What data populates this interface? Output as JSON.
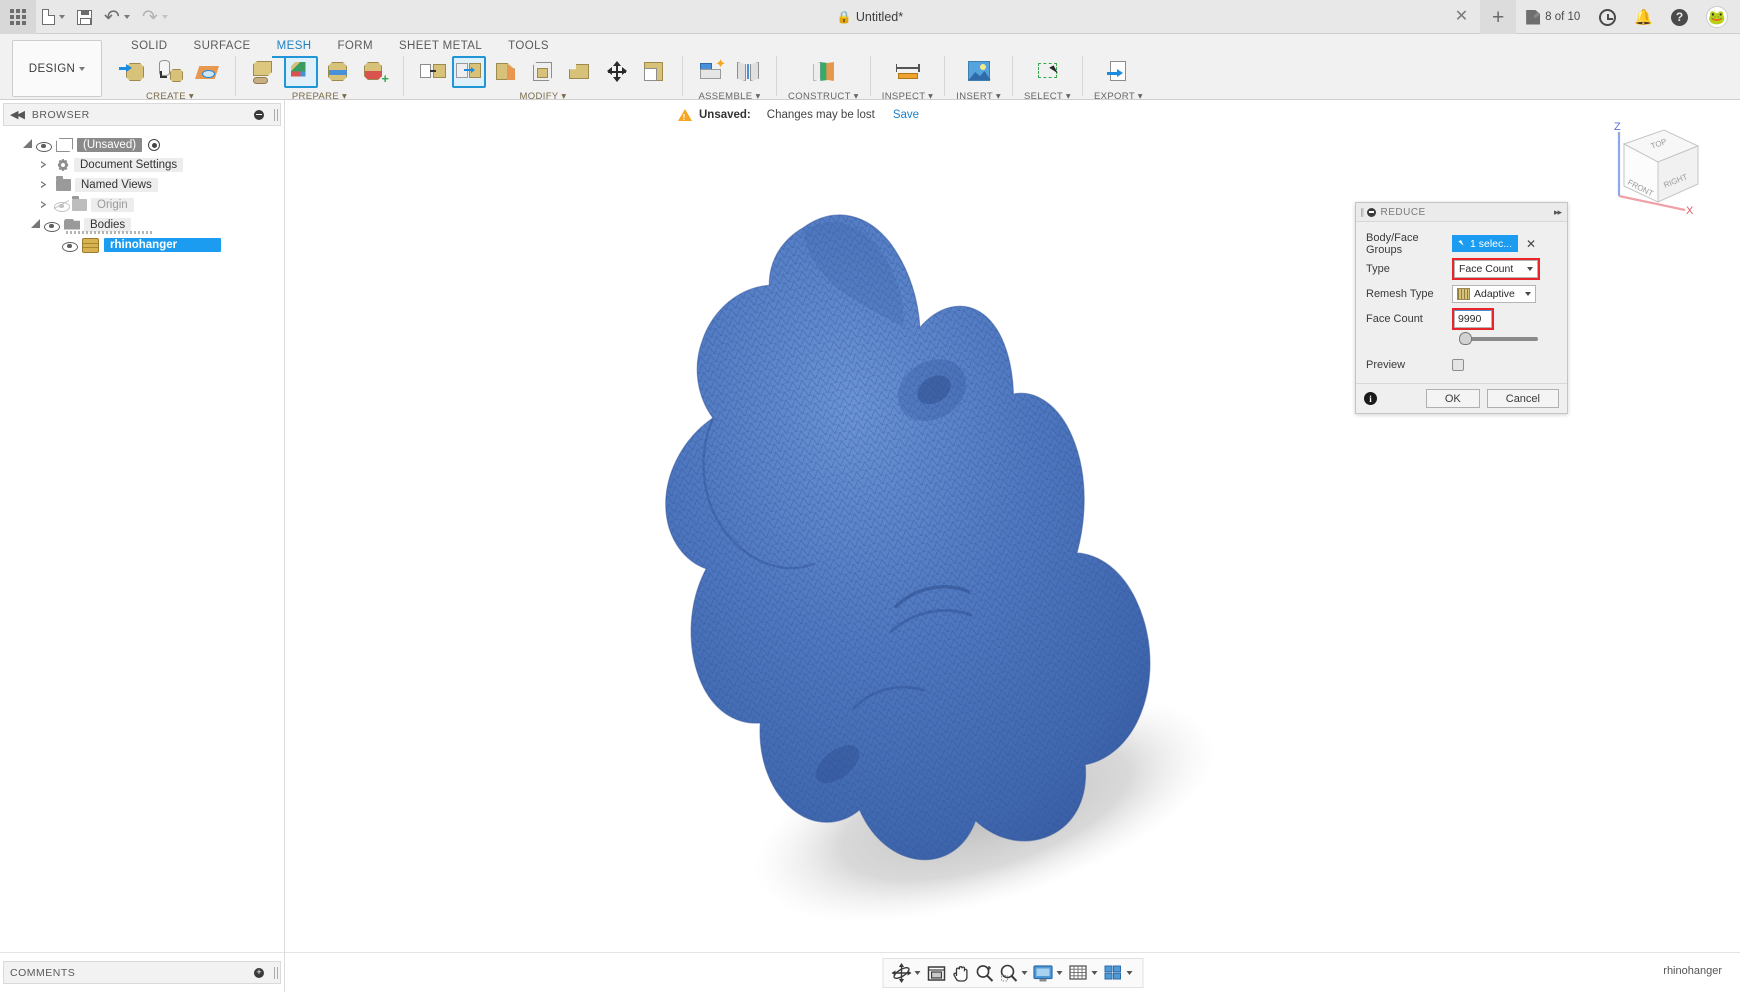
{
  "titlebar": {
    "app_menu_icon": "grid-icon",
    "new_doc_icon": "document-icon",
    "save_icon": "save-icon",
    "undo_icon": "undo-icon",
    "redo_icon": "redo-icon",
    "document_title": "Untitled*",
    "lock_icon": "lock-icon",
    "close_tab_icon": "close-icon",
    "new_tab_icon": "plus-icon",
    "job_status": "8 of 10",
    "job_icon": "pencil-document-icon",
    "recent_icon": "clock-icon",
    "notifications_icon": "bell-icon",
    "help_icon": "help-icon",
    "avatar_icon": "frog-avatar",
    "avatar_glyph": "🐸"
  },
  "ribbon": {
    "workspace_label": "DESIGN",
    "tabs": [
      {
        "label": "SOLID",
        "active": false
      },
      {
        "label": "SURFACE",
        "active": false
      },
      {
        "label": "MESH",
        "active": true
      },
      {
        "label": "FORM",
        "active": false
      },
      {
        "label": "SHEET METAL",
        "active": false
      },
      {
        "label": "TOOLS",
        "active": false
      }
    ],
    "groups": [
      {
        "label": "CREATE ▾",
        "name": "create"
      },
      {
        "label": "PREPARE ▾",
        "name": "prepare"
      },
      {
        "label": "MODIFY ▾",
        "name": "modify"
      },
      {
        "label": "ASSEMBLE ▾",
        "name": "assemble"
      },
      {
        "label": "CONSTRUCT ▾",
        "name": "construct"
      },
      {
        "label": "INSPECT ▾",
        "name": "inspect"
      },
      {
        "label": "INSERT ▾",
        "name": "insert"
      },
      {
        "label": "SELECT ▾",
        "name": "select"
      },
      {
        "label": "EXPORT ▾",
        "name": "export"
      }
    ]
  },
  "browser": {
    "header_title": "BROWSER",
    "collapse_icon": "collapse-left-icon",
    "minimize_icon": "minus-circle-icon",
    "tree": [
      {
        "label": "(Unsaved)",
        "icon": "document-cube-icon",
        "state": "unsaved",
        "indent": 0
      },
      {
        "label": "Document Settings",
        "icon": "gear-icon",
        "state": "normal",
        "indent": 1
      },
      {
        "label": "Named Views",
        "icon": "folder-icon",
        "state": "normal",
        "indent": 1
      },
      {
        "label": "Origin",
        "icon": "folder-icon",
        "state": "dim",
        "indent": 1
      },
      {
        "label": "Bodies",
        "icon": "bodies-icon",
        "state": "normal",
        "indent": 1
      },
      {
        "label": "rhinohanger",
        "icon": "mesh-body-icon",
        "state": "selected",
        "indent": 2
      }
    ]
  },
  "viewport": {
    "save_bar": {
      "warning_icon": "warning-triangle-icon",
      "status": "Unsaved:",
      "message": "Changes may be lost",
      "save_link": "Save"
    },
    "viewcube": {
      "top_face": "TOP",
      "front_face": "FRONT",
      "right_face": "RIGHT",
      "z_axis": "Z",
      "x_axis": "X"
    },
    "model_name": "rhinohanger",
    "mesh_color": "#4a74bc",
    "mesh_edge_color": "#30539a",
    "shadow_color": "#cfcfcf"
  },
  "reduce_dialog": {
    "title": "REDUCE",
    "minimize_icon": "minus-circle-icon",
    "expand_icon": "expand-right-icon",
    "fields": {
      "body_face_groups": {
        "label": "Body/Face Groups",
        "value": "1 selec...",
        "select_icon": "cursor-select-icon",
        "clear_icon": "close-icon"
      },
      "type": {
        "label": "Type",
        "value": "Face Count",
        "highlighted": true,
        "highlight_color": "#e8252a"
      },
      "remesh_type": {
        "label": "Remesh Type",
        "value": "Adaptive",
        "icon": "adaptive-mesh-icon"
      },
      "face_count": {
        "label": "Face Count",
        "value": "9990",
        "highlighted": true,
        "highlight_color": "#e8252a",
        "slider_position_pct": 6
      },
      "preview": {
        "label": "Preview",
        "checked": false
      }
    },
    "info_icon": "info-icon",
    "ok_label": "OK",
    "cancel_label": "Cancel"
  },
  "comments": {
    "header_title": "COMMENTS",
    "add_icon": "plus-circle-icon"
  },
  "statusbar": {
    "nav_tools": [
      {
        "name": "orbit-icon",
        "has_caret": true
      },
      {
        "name": "look-at-icon",
        "has_caret": false
      },
      {
        "name": "pan-icon",
        "has_caret": false
      },
      {
        "name": "zoom-icon",
        "has_caret": false
      },
      {
        "name": "zoom-window-icon",
        "has_caret": true
      },
      {
        "name": "display-settings-icon",
        "has_caret": true
      },
      {
        "name": "grid-snaps-icon",
        "has_caret": true
      },
      {
        "name": "viewport-layout-icon",
        "has_caret": true
      }
    ],
    "document_name": "rhinohanger"
  }
}
